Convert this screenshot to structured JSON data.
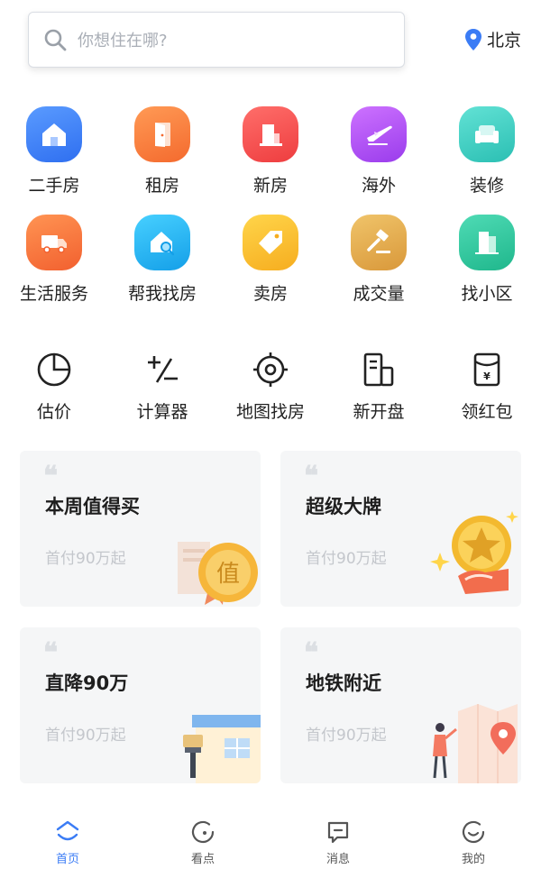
{
  "search": {
    "placeholder": "你想住在哪?"
  },
  "location": {
    "city": "北京"
  },
  "categories": [
    {
      "label": "二手房",
      "icon": "home-icon",
      "color": "#3d7ff5"
    },
    {
      "label": "租房",
      "icon": "door-icon",
      "color": "#f67b3c"
    },
    {
      "label": "新房",
      "icon": "building-icon",
      "color": "#f45352"
    },
    {
      "label": "海外",
      "icon": "airplane-icon",
      "color": "#b14df2"
    },
    {
      "label": "装修",
      "icon": "sofa-icon",
      "color": "#3fcfc4"
    },
    {
      "label": "生活服务",
      "icon": "truck-icon",
      "color": "#f7733b"
    },
    {
      "label": "帮我找房",
      "icon": "house-search-icon",
      "color": "#25b8f2"
    },
    {
      "label": "卖房",
      "icon": "tag-icon",
      "color": "#f9c032"
    },
    {
      "label": "成交量",
      "icon": "gavel-icon",
      "color": "#e6b04c"
    },
    {
      "label": "找小区",
      "icon": "community-icon",
      "color": "#2fc9a0"
    }
  ],
  "tools": [
    {
      "label": "估价",
      "icon": "pie-chart-icon"
    },
    {
      "label": "计算器",
      "icon": "calculator-icon"
    },
    {
      "label": "地图找房",
      "icon": "target-icon"
    },
    {
      "label": "新开盘",
      "icon": "new-building-icon"
    },
    {
      "label": "领红包",
      "icon": "red-packet-icon"
    }
  ],
  "cards": [
    {
      "title": "本周值得买",
      "sub": "首付90万起",
      "badge": "值"
    },
    {
      "title": "超级大牌",
      "sub": "首付90万起"
    },
    {
      "title": "直降90万",
      "sub": "首付90万起"
    },
    {
      "title": "地铁附近",
      "sub": "首付90万起"
    }
  ],
  "tabbar": [
    {
      "label": "首页",
      "icon": "home-tab-icon",
      "active": true
    },
    {
      "label": "看点",
      "icon": "discover-icon"
    },
    {
      "label": "消息",
      "icon": "message-icon"
    },
    {
      "label": "我的",
      "icon": "profile-icon"
    }
  ],
  "accent": "#3b7cf5"
}
